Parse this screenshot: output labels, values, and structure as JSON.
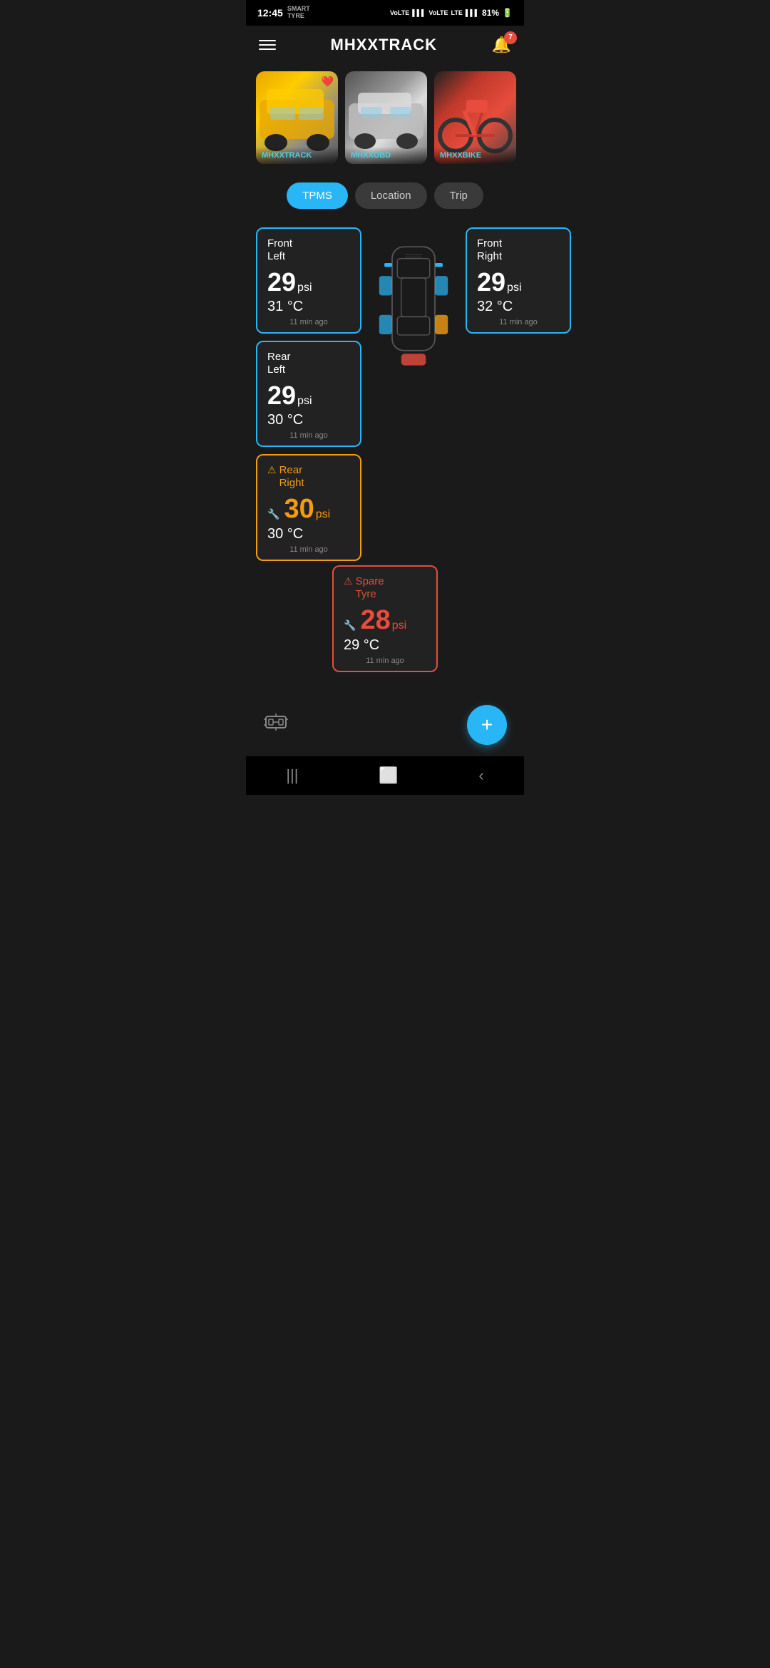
{
  "statusBar": {
    "time": "12:45",
    "smartTyre": "SMART TYRE",
    "signal1": "VoLTE LTE1",
    "signal2": "VoLTE LTE2",
    "battery": "81%"
  },
  "header": {
    "title": "MHXXTRACK",
    "notificationCount": "7",
    "menuLabel": "menu"
  },
  "vehicles": [
    {
      "name": "MHXXTRACK",
      "type": "yellow",
      "favorite": true
    },
    {
      "name": "MHXXOBD",
      "type": "white",
      "favorite": false
    },
    {
      "name": "MHXXBIKE",
      "type": "red",
      "favorite": false
    }
  ],
  "tabs": [
    {
      "label": "TPMS",
      "active": true
    },
    {
      "label": "Location",
      "active": false
    },
    {
      "label": "Trip",
      "active": false
    }
  ],
  "tireCards": {
    "frontLeft": {
      "name": "Front\nLeft",
      "psi": "29",
      "unit": "psi",
      "temp": "31 °C",
      "time": "11 min ago",
      "status": "normal"
    },
    "frontRight": {
      "name": "Front\nRight",
      "psi": "29",
      "unit": "psi",
      "temp": "32 °C",
      "time": "11 min ago",
      "status": "normal"
    },
    "rearLeft": {
      "name": "Rear\nLeft",
      "psi": "29",
      "unit": "psi",
      "temp": "30 °C",
      "time": "11 min ago",
      "status": "normal"
    },
    "rearRight": {
      "name": "Rear\nRight",
      "psi": "30",
      "unit": "psi",
      "temp": "30 °C",
      "time": "11 min ago",
      "status": "warning"
    },
    "spare": {
      "name": "Spare\nTyre",
      "psi": "28",
      "unit": "psi",
      "temp": "29 °C",
      "time": "11 min ago",
      "status": "danger"
    }
  },
  "addButton": "+",
  "colors": {
    "accent": "#29b6f6",
    "warning": "#f39c12",
    "danger": "#e74c3c",
    "normal": "#29b6f6",
    "dark": "#1a1a1a"
  }
}
